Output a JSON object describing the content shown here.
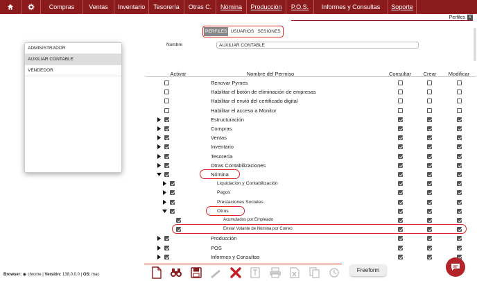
{
  "nav": {
    "items": [
      "Compras",
      "Ventas",
      "Inventario",
      "Tesorería",
      "Otras C.",
      "Nómina",
      "Producción",
      "P.O.S.",
      "Informes y Consultas",
      "Soporte"
    ]
  },
  "window_tab": {
    "label": "Perfiles",
    "close": "x"
  },
  "tabs": [
    {
      "label": "PERFILES",
      "active": true
    },
    {
      "label": "USUARIOS",
      "active": false
    },
    {
      "label": "SESIONES",
      "active": false
    }
  ],
  "profiles": [
    {
      "label": "ADMINISTRADOR",
      "selected": false
    },
    {
      "label": "AUXILIAR CONTABLE",
      "selected": true
    },
    {
      "label": "VENDEDOR",
      "selected": false
    }
  ],
  "form": {
    "nombre_label": "Nombre",
    "nombre_value": "AUXILIAR CONTABLE"
  },
  "table": {
    "headers": {
      "activar": "Activar",
      "nombre": "Nombre del Permiso",
      "consultar": "Consultar",
      "crear": "Crear",
      "modificar": "Modificar"
    },
    "rows": [
      {
        "label": "Renovar Pymes",
        "level": 0,
        "arrow": "none",
        "activar": false,
        "consultar": false,
        "crear": false,
        "modificar": false
      },
      {
        "label": "Habilitar el botón de eliminación de empresas",
        "level": 0,
        "arrow": "none",
        "activar": false,
        "consultar": false,
        "crear": false,
        "modificar": false
      },
      {
        "label": "Habilitar el envió del certificado digital",
        "level": 0,
        "arrow": "none",
        "activar": false,
        "consultar": false,
        "crear": false,
        "modificar": false
      },
      {
        "label": "Habilitar el acceso a Monitor",
        "level": 0,
        "arrow": "none",
        "activar": false,
        "consultar": false,
        "crear": false,
        "modificar": false
      },
      {
        "label": "Estructuración",
        "level": 0,
        "arrow": "right",
        "activar": true,
        "consultar": true,
        "crear": true,
        "modificar": true
      },
      {
        "label": "Compras",
        "level": 0,
        "arrow": "right",
        "activar": true,
        "consultar": true,
        "crear": true,
        "modificar": true
      },
      {
        "label": "Ventas",
        "level": 0,
        "arrow": "right",
        "activar": true,
        "consultar": true,
        "crear": true,
        "modificar": true
      },
      {
        "label": "Inventario",
        "level": 0,
        "arrow": "right",
        "activar": true,
        "consultar": true,
        "crear": true,
        "modificar": true
      },
      {
        "label": "Tesorería",
        "level": 0,
        "arrow": "right",
        "activar": true,
        "consultar": true,
        "crear": true,
        "modificar": true
      },
      {
        "label": "Otras Contabilizaciones",
        "level": 0,
        "arrow": "right",
        "activar": true,
        "consultar": true,
        "crear": true,
        "modificar": true
      },
      {
        "label": "Nómina",
        "level": 0,
        "arrow": "down",
        "activar": true,
        "consultar": true,
        "crear": true,
        "modificar": true,
        "highlight": true
      },
      {
        "label": "Liquidación y Contabilización",
        "level": 1,
        "arrow": "right",
        "activar": true,
        "consultar": true,
        "crear": true,
        "modificar": true
      },
      {
        "label": "Pagos",
        "level": 1,
        "arrow": "right",
        "activar": true,
        "consultar": true,
        "crear": true,
        "modificar": true
      },
      {
        "label": "Prestaciones Sociales",
        "level": 1,
        "arrow": "right",
        "activar": true,
        "consultar": true,
        "crear": true,
        "modificar": true
      },
      {
        "label": "Otros",
        "level": 1,
        "arrow": "down",
        "activar": true,
        "consultar": true,
        "crear": true,
        "modificar": true,
        "highlight": true
      },
      {
        "label": "Acumulados por Empleado",
        "level": 2,
        "arrow": "none",
        "activar": true,
        "consultar": true,
        "crear": true,
        "modificar": true
      },
      {
        "label": "Enviar Volante de Nómina por Correo",
        "level": 2,
        "arrow": "none",
        "activar": true,
        "consultar": true,
        "crear": true,
        "modificar": true,
        "highlight_row": true
      },
      {
        "label": "Producción",
        "level": 0,
        "arrow": "right",
        "activar": true,
        "consultar": true,
        "crear": true,
        "modificar": true
      },
      {
        "label": "POS",
        "level": 0,
        "arrow": "right",
        "activar": true,
        "consultar": true,
        "crear": true,
        "modificar": true
      },
      {
        "label": "Informes y Consultas",
        "level": 0,
        "arrow": "right",
        "activar": true,
        "consultar": true,
        "crear": true,
        "modificar": true
      }
    ]
  },
  "footer": {
    "browser_label": "Browser:",
    "browser": "chrome",
    "version_label": "Versión:",
    "version": "138.0.0.0",
    "os_label": "OS:",
    "os": "mac"
  },
  "toolbar_icons": [
    "new-document-icon",
    "search-binoculars-icon",
    "save-icon",
    "edit-pencil-icon",
    "delete-x-icon",
    "text-icon",
    "print-icon",
    "excel-export-icon",
    "copy-icon",
    "history-icon"
  ],
  "freeform": "Freeform",
  "colors": {
    "brand": "#8b1a1d",
    "highlight": "#dd2222"
  }
}
